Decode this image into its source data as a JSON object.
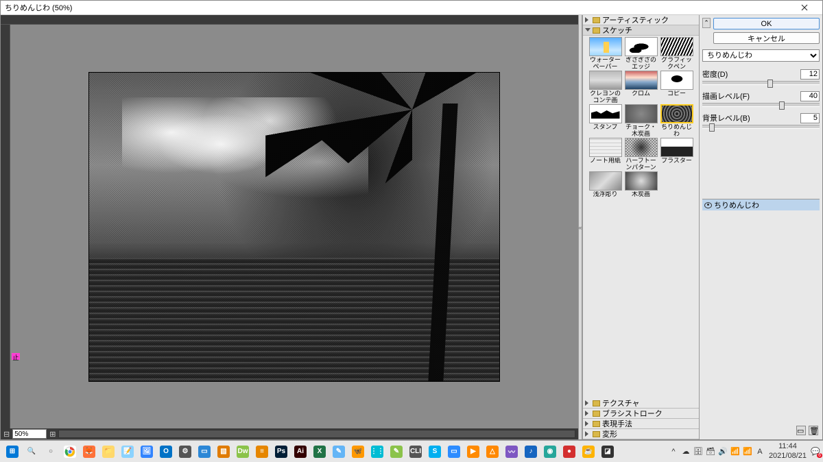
{
  "titlebar": {
    "title": "ちりめんじわ (50%)"
  },
  "canvas": {
    "zoom": "50%",
    "marker": "止"
  },
  "categories": {
    "artistic": "アーティスティック",
    "sketch": "スケッチ",
    "texture": "テクスチャ",
    "brush": "ブラシストローク",
    "presentation": "表現手法",
    "distort": "変形"
  },
  "thumbs": [
    {
      "label": "ウォーターペーパー",
      "cls": "tb-water"
    },
    {
      "label": "ぎざぎざのエッジ",
      "cls": "tb-edge"
    },
    {
      "label": "グラフィックペン",
      "cls": "tb-graphic"
    },
    {
      "label": "クレヨンのコンテ画",
      "cls": "tb-crayon"
    },
    {
      "label": "クロム",
      "cls": "tb-chrome"
    },
    {
      "label": "コピー",
      "cls": "tb-copy"
    },
    {
      "label": "スタンプ",
      "cls": "tb-stamp"
    },
    {
      "label": "チョーク・木炭画",
      "cls": "tb-chalk"
    },
    {
      "label": "ちりめんじわ",
      "cls": "tb-reticulation",
      "selected": true
    },
    {
      "label": "ノート用紙",
      "cls": "tb-notepaper"
    },
    {
      "label": "ハーフトーンパターン",
      "cls": "tb-halftone"
    },
    {
      "label": "プラスター",
      "cls": "tb-plaster"
    },
    {
      "label": "浅浮彫り",
      "cls": "tb-bas"
    },
    {
      "label": "木炭画",
      "cls": "tb-charcoal"
    }
  ],
  "controls": {
    "ok": "OK",
    "cancel": "キャンセル",
    "filter_name": "ちりめんじわ",
    "sliders": [
      {
        "label": "密度(D)",
        "value": "12",
        "pos": 58
      },
      {
        "label": "描画レベル(F)",
        "value": "40",
        "pos": 68
      },
      {
        "label": "背景レベル(B)",
        "value": "5",
        "pos": 8
      }
    ]
  },
  "layer_name": "ちりめんじわ",
  "taskbar": {
    "apps": [
      {
        "bg": "#0078d7",
        "ch": "⊞"
      },
      {
        "bg": "transparent",
        "ch": "🔍",
        "clr": "#555"
      },
      {
        "bg": "transparent",
        "ch": "○",
        "clr": "#555"
      },
      {
        "bg": "#fff",
        "ch": "",
        "svg": "chrome"
      },
      {
        "bg": "#ff7139",
        "ch": "🦊"
      },
      {
        "bg": "#ffd86b",
        "ch": "📁"
      },
      {
        "bg": "#8bd3ff",
        "ch": "📝"
      },
      {
        "bg": "#3284ff",
        "ch": "🖼"
      },
      {
        "bg": "#0072c6",
        "ch": "O"
      },
      {
        "bg": "#555",
        "ch": "⚙"
      },
      {
        "bg": "#2c87d6",
        "ch": "▭"
      },
      {
        "bg": "#e07b00",
        "ch": "▧"
      },
      {
        "bg": "#8bc34a",
        "ch": "Dw"
      },
      {
        "bg": "#e68600",
        "ch": "≡"
      },
      {
        "bg": "#001e36",
        "ch": "Ps"
      },
      {
        "bg": "#330000",
        "ch": "Ai"
      },
      {
        "bg": "#217346",
        "ch": "X"
      },
      {
        "bg": "#64b5f6",
        "ch": "✎"
      },
      {
        "bg": "#ff9800",
        "ch": "🦋"
      },
      {
        "bg": "#00bcd4",
        "ch": "⋮⋮"
      },
      {
        "bg": "#8bc34a",
        "ch": "✎"
      },
      {
        "bg": "#555",
        "ch": "CLI"
      },
      {
        "bg": "#00aff0",
        "ch": "S"
      },
      {
        "bg": "#2d8cff",
        "ch": "▭"
      },
      {
        "bg": "#ff8a00",
        "ch": "▶"
      },
      {
        "bg": "#ff8800",
        "ch": "△"
      },
      {
        "bg": "#7e57c2",
        "ch": "〰"
      },
      {
        "bg": "#1565c0",
        "ch": "♪"
      },
      {
        "bg": "#26a69a",
        "ch": "◉"
      },
      {
        "bg": "#d32f2f",
        "ch": "●"
      },
      {
        "bg": "#ffb300",
        "ch": "☕"
      },
      {
        "bg": "#333",
        "ch": "◪"
      }
    ],
    "tray": [
      "^",
      "☁",
      "🗄",
      "🗃",
      "🔊",
      "📶",
      "📶",
      "A"
    ],
    "time": "11:44",
    "date": "2021/08/21",
    "notify": "6"
  }
}
